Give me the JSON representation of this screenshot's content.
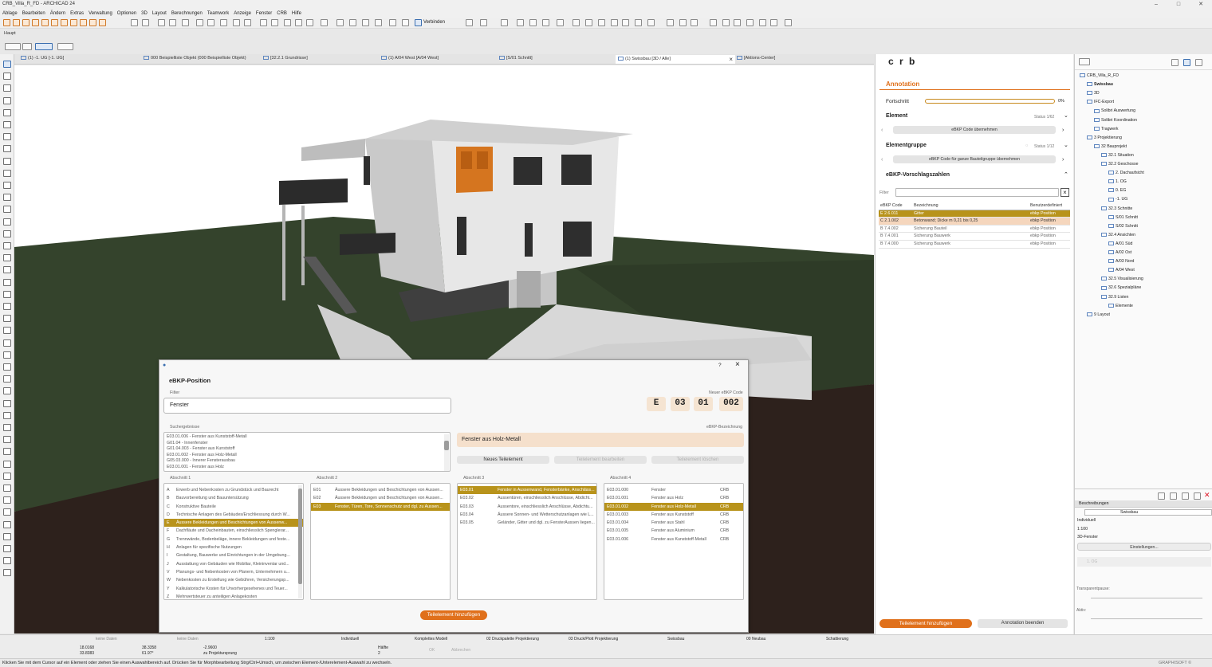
{
  "app": {
    "title": "CRB_Villa_R_FD - ARCHICAD 24"
  },
  "window_controls": {
    "minimize": "–",
    "maximize": "□",
    "close": "✕"
  },
  "menu": [
    "Ablage",
    "Bearbeiten",
    "Ändern",
    "Extras",
    "Verwaltung",
    "Optionen",
    "3D",
    "Layout",
    "Berechnungen",
    "Teamwork",
    "Anzeige",
    "Fenster",
    "CRB",
    "Hilfe"
  ],
  "toolbar": {
    "connect_label": "Verbinden"
  },
  "toolbox_label": "Haupt",
  "tabs": [
    {
      "label": "(1) -1. UG [-1. UG]"
    },
    {
      "label": "000 Beispielliste Objekt (000 Beispielliste Objekt)"
    },
    {
      "label": "[32.2.1 Grundrisse]"
    },
    {
      "label": "(1) A/04 West [A/04 West]"
    },
    {
      "label": "[S/01 Schnitt]"
    },
    {
      "label": "(1) Swissbau [3D / Alle]"
    },
    {
      "label": "[Aktions-Center]"
    }
  ],
  "tab_close": "×",
  "plugin": {
    "logo": "c r b",
    "annotation_title": "Annotation",
    "progress_label": "Fortschritt",
    "progress_pct": 0,
    "progress_text": "0%",
    "element_title": "Element",
    "element_status": "Status 1/62",
    "element_button": "eBKP Code übernehmen",
    "group_title": "Elementgruppe",
    "group_status": "Status 1/12",
    "group_button": "eBKP Code für ganze Bauteilgruppe übernehmen",
    "suggestions_title": "eBKP-Vorschlagszahlen",
    "filter_label": "Filter",
    "filter_clear": "×",
    "table_headers": [
      "eBKP Code",
      "Bezeichnung",
      "Benutzerdefiniert"
    ],
    "table_rows": [
      {
        "code": "E 2.6.011",
        "name": "Gitter",
        "custom": "ebkp Position",
        "state": "selected"
      },
      {
        "code": "C 2.1.002",
        "name": "Betonwand; Dicke m 0,21 bis 0,25",
        "custom": "ebkp Position",
        "state": "hover"
      },
      {
        "code": "B 7.4.002",
        "name": "Sicherung Bauteil",
        "custom": "ebkp Position",
        "state": ""
      },
      {
        "code": "B 7.4.001",
        "name": "Sicherung Bauwerk",
        "custom": "ebkp Position",
        "state": ""
      },
      {
        "code": "B 7.4.000",
        "name": "Sicherung Bauwerk",
        "custom": "ebkp Position",
        "state": ""
      }
    ],
    "add_button": "Teilelement hinzufügen",
    "end_button": "Annotation beenden",
    "footer_left": "Developed for CRB by kiLabs AG 2022",
    "footer_right": "Version 1.02"
  },
  "navigator": {
    "items": [
      {
        "label": "CRB_Villa_R_FD",
        "level": 0,
        "bold": false
      },
      {
        "label": "Swissbau",
        "level": 1,
        "bold": true
      },
      {
        "label": "3D",
        "level": 1,
        "bold": false
      },
      {
        "label": "IFC-Export",
        "level": 1,
        "bold": false
      },
      {
        "label": "Solibri Auswertung",
        "level": 2,
        "bold": false
      },
      {
        "label": "Solibri Koordination",
        "level": 2,
        "bold": false
      },
      {
        "label": "Tragwerk",
        "level": 2,
        "bold": false
      },
      {
        "label": "3 Projektierung",
        "level": 1,
        "bold": false
      },
      {
        "label": "32 Bauprojekt",
        "level": 2,
        "bold": false
      },
      {
        "label": "32.1 Situation",
        "level": 3,
        "bold": false
      },
      {
        "label": "32.2 Geschosse",
        "level": 3,
        "bold": false
      },
      {
        "label": "2. Dachaufsicht",
        "level": 4,
        "bold": false
      },
      {
        "label": "1. OG",
        "level": 4,
        "bold": false
      },
      {
        "label": "0. EG",
        "level": 4,
        "bold": false
      },
      {
        "label": "-1. UG",
        "level": 4,
        "bold": false
      },
      {
        "label": "32.3 Schnitte",
        "level": 3,
        "bold": false
      },
      {
        "label": "S/01 Schnitt",
        "level": 4,
        "bold": false
      },
      {
        "label": "S/02 Schnitt",
        "level": 4,
        "bold": false
      },
      {
        "label": "32.4 Ansichten",
        "level": 3,
        "bold": false
      },
      {
        "label": "A/01 Süd",
        "level": 4,
        "bold": false
      },
      {
        "label": "A/02 Ost",
        "level": 4,
        "bold": false
      },
      {
        "label": "A/03 Nord",
        "level": 4,
        "bold": false
      },
      {
        "label": "A/04 West",
        "level": 4,
        "bold": false
      },
      {
        "label": "32.5 Visualisierung",
        "level": 3,
        "bold": false
      },
      {
        "label": "32.6 Spezialpläne",
        "level": 3,
        "bold": false
      },
      {
        "label": "32.9 Listen",
        "level": 3,
        "bold": false
      },
      {
        "label": "Elemente",
        "level": 4,
        "bold": false
      },
      {
        "label": "9 Layout",
        "level": 1,
        "bold": false
      }
    ],
    "props_title": "Beschreibungen",
    "props_name": "Swissbau",
    "props_rows": [
      "Individuell",
      "1:100",
      "3D-Fenster"
    ],
    "settings_button": "Einstellungen...",
    "layer": "1. OG",
    "transparency_label": "Transparentpause:",
    "active_label": "Aktiv:"
  },
  "dialog": {
    "title": "eBKP-Position",
    "help": "?",
    "close": "×",
    "filter_label": "Filter",
    "filter_value": "Fenster",
    "new_code_label": "Neuer eBKP Code",
    "code": [
      "E",
      "03",
      "01",
      "002"
    ],
    "search_label": "Suchergebnisse",
    "search_results": [
      "E03.01.006 - Fenster aus Kunststoff-Metall",
      "G01.04 - Innenfenster",
      "G01.04.003 - Fenster aus Kunststoff",
      "E03.01.002 - Fenster aus Holz-Metall",
      "G05.03.000 - Innerer Fensterausbau",
      "E03.01.001 - Fenster aus Holz"
    ],
    "designation_label": "eBKP-Bezeichnung",
    "designation_value": "Fenster aus Holz-Metall",
    "btn_new": "Neues Teilelement",
    "btn_edit": "Teilelement bearbeiten",
    "btn_delete": "Teilelement löschen",
    "sections": [
      {
        "title": "Abschnitt 1",
        "items": [
          {
            "code": "A",
            "text": "Erwerb und Nebenkosten zu Grundstück und Baurecht"
          },
          {
            "code": "B",
            "text": "Bauvorbereitung und Bauuntersützung"
          },
          {
            "code": "C",
            "text": "Konstruktive Bauteile"
          },
          {
            "code": "D",
            "text": "Technische Anlagen des Gebäudes/Erschliessung durch W..."
          },
          {
            "code": "E",
            "text": "Äussere Bekleidungen und Beschichtungen von Aussenw...",
            "sel": true
          },
          {
            "code": "F",
            "text": "Dachfläute und Dacheinbauten, einschliesslich Spenglerar..."
          },
          {
            "code": "G",
            "text": "Trennwände, Bodenbeläge, innere Bekleidungen und feste..."
          },
          {
            "code": "H",
            "text": "Anlagen für spezifische Nutzungen"
          },
          {
            "code": "I",
            "text": "Gestaltung, Bauwerke und Einrichtungen in der Umgebung..."
          },
          {
            "code": "J",
            "text": "Ausstattung von Gebäuden wie Mobiliar, Kleininventar und..."
          },
          {
            "code": "V",
            "text": "Planungs- und Nebenkosten von Planern, Unternehmern u..."
          },
          {
            "code": "W",
            "text": "Nebenkosten zu Erstellung wie Gebühren, Versicherungsp..."
          },
          {
            "code": "Y",
            "text": "Kalkulatorische Kosten für Unvorhergesehenes und Teuer..."
          },
          {
            "code": "Z",
            "text": "Mehrwertsteuer zu anteiligen Anlagekosten"
          }
        ]
      },
      {
        "title": "Abschnitt 2",
        "items": [
          {
            "code": "E01",
            "text": "Äussere Bekleidungen und Beschichtungen von Aussen..."
          },
          {
            "code": "E02",
            "text": "Äussere Bekleidungen und Beschichtungen von Aussen..."
          },
          {
            "code": "E03",
            "text": "Fenster, Türen, Tore, Sonnenschutz und dgl. zu Aussen...",
            "sel": true
          }
        ]
      },
      {
        "title": "Abschnitt 3",
        "items": [
          {
            "code": "E03.01",
            "text": "Fenster in Aussenwand, Fensterbänke, Anschläss...",
            "sel": true
          },
          {
            "code": "E03.02",
            "text": "Aussentüren, einschliesslich Anschlüsse, Abdicht..."
          },
          {
            "code": "E03.03",
            "text": "Aussentore, einschliesslich Anschlüsse, Abdichtu..."
          },
          {
            "code": "E03.04",
            "text": "Äussere Sonnen- und Wetterschutzanlagen wie L..."
          },
          {
            "code": "E03.05",
            "text": "Geländer, Gitter und dgl. zu FensterAussen liegen..."
          }
        ]
      },
      {
        "title": "Abschnitt 4",
        "items": [
          {
            "code": "E03.01.000",
            "text": "Fenster",
            "src": "CRB"
          },
          {
            "code": "E03.01.001",
            "text": "Fenster aus Holz",
            "src": "CRB"
          },
          {
            "code": "E03.01.002",
            "text": "Fenster aus Holz-Metall",
            "src": "CRB",
            "sel": true
          },
          {
            "code": "E03.01.003",
            "text": "Fenster aus Kunststoff",
            "src": "CRB"
          },
          {
            "code": "E03.01.004",
            "text": "Fenster aus Stahl",
            "src": "CRB"
          },
          {
            "code": "E03.01.005",
            "text": "Fenster aus Aluminium",
            "src": "CRB"
          },
          {
            "code": "E03.01.006",
            "text": "Fenster aus Kunststoff-Metall",
            "src": "CRB"
          }
        ]
      }
    ],
    "add_button": "Teilelement hinzufügen"
  },
  "bottom": {
    "no_data1": "keine Daten",
    "no_data2": "keine Daten",
    "scale": "1:100",
    "layer_combo": "Individuell",
    "model": "Komplettes Modell",
    "print": "02 Druckpalette Projektierung",
    "plot": "03 Druck/Plott Projektierung",
    "set": "Swissbau",
    "reno": "00 Neubau",
    "shade": "Schattierung",
    "dx": "18.0168",
    "dy": "33.8383",
    "dz": "38.3358",
    "angle": "61.97°",
    "elev": "-2.9600",
    "ref": "zu Projektursprung",
    "half": "Hälfte",
    "num": "2",
    "ok": "OK",
    "cancel": "Abbrechen"
  },
  "status_text": "Klicken Sie mit dem Cursor auf ein Element oder ziehen Sie einen Auswahlbereich auf. Drücken Sie für Morphbearbeitung Strg/Ctrl+Umsch, um zwischen Element-/Unterelement-Auswahl zu wechseln.",
  "brand": "GRAPHISOFT ©",
  "colors": {
    "accent": "#e0701b",
    "gold": "#b8931b",
    "peach": "#f5e4d2",
    "grass": "#34432c",
    "soil": "#2d211c"
  }
}
